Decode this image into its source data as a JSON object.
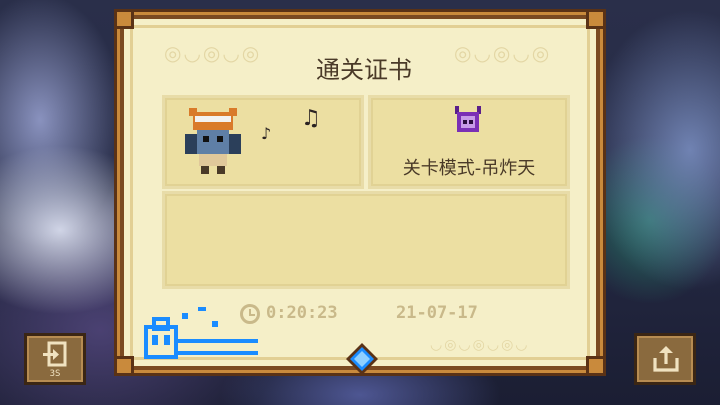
{
  "certificate": {
    "title": "通关证书",
    "mode_label": "关卡模式-吊炸天",
    "time": "0:20:23",
    "date": "21-07-17"
  },
  "buttons": {
    "exit_countdown": "3S"
  },
  "icons": {
    "hero": "hero-fox-hat-icon",
    "mode": "purple-horned-demon-icon",
    "notes": "music-notes-icon",
    "clock": "clock-icon",
    "gem": "blue-gem-icon",
    "exit": "exit-door-icon",
    "share": "share-icon"
  },
  "colors": {
    "panel_bg": "#f5efc8",
    "frame": "#7a4a22",
    "card": "#ecdfa2",
    "stat_text": "#c9b98a",
    "stamp_blue": "#1a8cff"
  }
}
